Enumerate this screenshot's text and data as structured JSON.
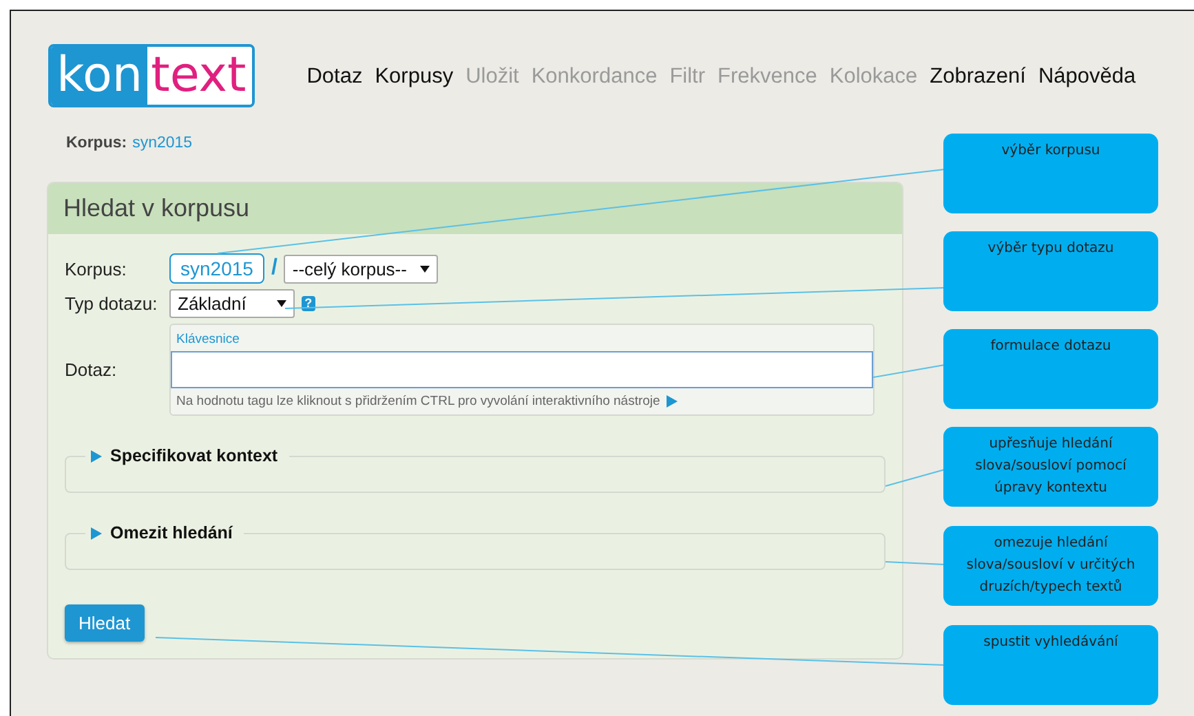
{
  "logo": {
    "left": "kon",
    "right": "text"
  },
  "nav": [
    {
      "label": "Dotaz",
      "disabled": false
    },
    {
      "label": "Korpusy",
      "disabled": false
    },
    {
      "label": "Uložit",
      "disabled": true
    },
    {
      "label": "Konkordance",
      "disabled": true
    },
    {
      "label": "Filtr",
      "disabled": true
    },
    {
      "label": "Frekvence",
      "disabled": true
    },
    {
      "label": "Kolokace",
      "disabled": true
    },
    {
      "label": "Zobrazení",
      "disabled": false
    },
    {
      "label": "Nápověda",
      "disabled": false
    }
  ],
  "breadcrumb": {
    "label": "Korpus:",
    "value": "syn2015"
  },
  "panel": {
    "title": "Hledat v korpusu",
    "corpus": {
      "label": "Korpus:",
      "value": "syn2015",
      "separator": "/",
      "subcorpus": "--celý korpus--"
    },
    "query_type": {
      "label": "Typ dotazu:",
      "value": "Základní",
      "help": "?"
    },
    "query": {
      "label": "Dotaz:",
      "keyboard": "Klávesnice",
      "hint": "Na hodnotu tagu lze kliknout s přidržením CTRL pro vyvolání interaktivního nástroje"
    },
    "sections": [
      {
        "title": "Specifikovat kontext",
        "expanded": false
      },
      {
        "title": "Omezit hledání",
        "expanded": false
      }
    ],
    "submit": "Hledat"
  },
  "callouts": [
    {
      "text": "výběr korpusu"
    },
    {
      "text": "výběr typu dotazu"
    },
    {
      "text": "formulace dotazu"
    },
    {
      "text": "upřesňuje hledání slova/sousloví pomocí úpravy kontextu"
    },
    {
      "text": "omezuje hledání slova/sousloví v určitých druzích/typech textů"
    },
    {
      "text": "spustit vyhledávání"
    }
  ]
}
